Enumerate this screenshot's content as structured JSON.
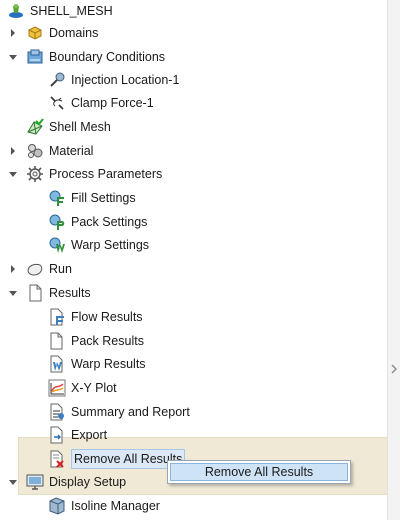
{
  "tree": {
    "root": {
      "label": "SHELL_MESH",
      "icon": "study-icon"
    },
    "domains": {
      "label": "Domains",
      "icon": "domains-icon",
      "expander": "collapsed"
    },
    "boundary_conditions": {
      "label": "Boundary Conditions",
      "icon": "boundary-conditions-icon",
      "expander": "expanded",
      "children": [
        {
          "label": "Injection Location-1",
          "icon": "injection-location-icon"
        },
        {
          "label": "Clamp Force-1",
          "icon": "clamp-force-icon"
        }
      ]
    },
    "shell_mesh": {
      "label": "Shell Mesh",
      "icon": "mesh-icon"
    },
    "material": {
      "label": "Material",
      "icon": "material-icon",
      "expander": "collapsed"
    },
    "process_parameters": {
      "label": "Process Parameters",
      "icon": "gear-icon",
      "expander": "expanded",
      "children": [
        {
          "label": "Fill Settings",
          "icon": "fill-settings-icon"
        },
        {
          "label": "Pack Settings",
          "icon": "pack-settings-icon"
        },
        {
          "label": "Warp Settings",
          "icon": "warp-settings-icon"
        }
      ]
    },
    "run": {
      "label": "Run",
      "icon": "run-icon",
      "expander": "collapsed"
    },
    "results": {
      "label": "Results",
      "icon": "document-icon",
      "expander": "expanded",
      "children": [
        {
          "label": "Flow Results",
          "icon": "flow-results-icon"
        },
        {
          "label": "Pack Results",
          "icon": "document-icon"
        },
        {
          "label": "Warp Results",
          "icon": "warp-results-icon"
        },
        {
          "label": "X-Y Plot",
          "icon": "xy-plot-icon"
        },
        {
          "label": "Summary and Report",
          "icon": "report-icon"
        },
        {
          "label": "Export",
          "icon": "export-icon"
        },
        {
          "label": "Remove All Results",
          "icon": "remove-results-icon",
          "selected": true
        }
      ]
    },
    "display_setup": {
      "label": "Display Setup",
      "icon": "display-setup-icon",
      "expander": "expanded",
      "children": [
        {
          "label": "Isoline Manager",
          "icon": "isoline-manager-icon"
        }
      ]
    }
  },
  "context_menu": {
    "items": [
      {
        "label": "Remove All Results"
      }
    ]
  },
  "colors": {
    "highlight_band": "#f0e9d6",
    "menu_hover": "#cfe3f6",
    "selection": "#dce8f5"
  }
}
